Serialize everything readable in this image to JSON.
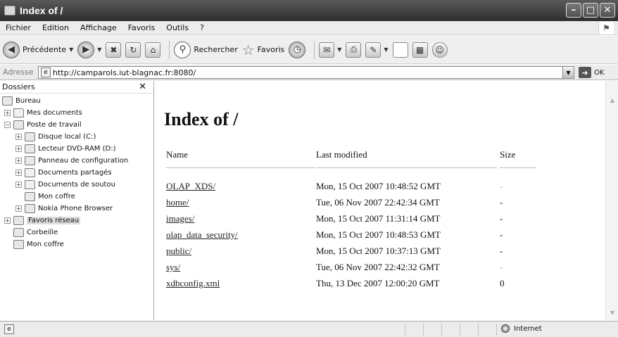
{
  "window": {
    "title": "Index of /"
  },
  "menu": [
    {
      "label": "Fichier"
    },
    {
      "label": "Edition"
    },
    {
      "label": "Affichage"
    },
    {
      "label": "Favoris"
    },
    {
      "label": "Outils"
    },
    {
      "label": "?"
    }
  ],
  "toolbar": {
    "back_label": "Précédente",
    "search_label": "Rechercher",
    "favorites_label": "Favoris"
  },
  "address": {
    "label": "Adresse",
    "url": "http://camparols.iut-blagnac.fr:8080/",
    "go_label": "OK"
  },
  "folders": {
    "title": "Dossiers",
    "items": [
      {
        "label": "Bureau"
      },
      {
        "label": "Mes documents"
      },
      {
        "label": "Poste de travail"
      },
      {
        "label": "Disque local (C:)"
      },
      {
        "label": "Lecteur DVD-RAM (D:)"
      },
      {
        "label": "Panneau de configuration"
      },
      {
        "label": "Documents partagés"
      },
      {
        "label": "Documents de soutou"
      },
      {
        "label": "Mon coffre"
      },
      {
        "label": "Nokia Phone Browser"
      },
      {
        "label": "Favoris réseau"
      },
      {
        "label": "Corbeille"
      },
      {
        "label": "Mon coffre"
      }
    ]
  },
  "page": {
    "heading": "Index of /",
    "columns": {
      "name": "Name",
      "modified": "Last modified",
      "size": "Size"
    },
    "rows": [
      {
        "name": "OLAP_XDS/",
        "modified": "Mon, 15 Oct 2007 10:48:52 GMT",
        "size": "-"
      },
      {
        "name": "home/",
        "modified": "Tue, 06 Nov 2007 22:42:34 GMT",
        "size": "-"
      },
      {
        "name": "images/",
        "modified": "Mon, 15 Oct 2007 11:31:14 GMT",
        "size": "-"
      },
      {
        "name": "olap_data_security/",
        "modified": "Mon, 15 Oct 2007 10:48:53 GMT",
        "size": "-"
      },
      {
        "name": "public/",
        "modified": "Mon, 15 Oct 2007 10:37:13 GMT",
        "size": "-"
      },
      {
        "name": "sys/",
        "modified": "Tue, 06 Nov 2007 22:42:32 GMT",
        "size": "-"
      },
      {
        "name": "xdbconfig.xml",
        "modified": "Thu, 13 Dec 2007 12:00:20 GMT",
        "size": "0"
      }
    ]
  },
  "status": {
    "zone": "Internet"
  }
}
